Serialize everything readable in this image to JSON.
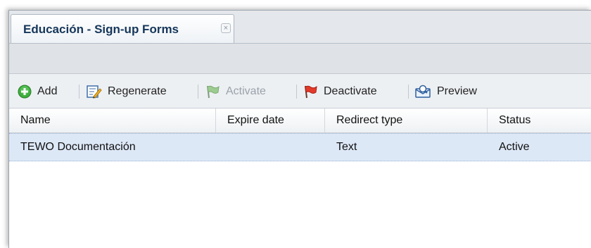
{
  "tab": {
    "title": "Educación - Sign-up Forms",
    "close_glyph": "×"
  },
  "toolbar": {
    "add": {
      "label": "Add",
      "icon": "add-icon"
    },
    "regenerate": {
      "label": "Regenerate",
      "icon": "regenerate-icon"
    },
    "activate": {
      "label": "Activate",
      "icon": "green-flag-icon",
      "disabled": true
    },
    "deactivate": {
      "label": "Deactivate",
      "icon": "red-flag-icon"
    },
    "preview": {
      "label": "Preview",
      "icon": "preview-icon"
    }
  },
  "grid": {
    "columns": [
      "Name",
      "Expire date",
      "Redirect type",
      "Status"
    ],
    "rows": [
      {
        "name": "TEWO Documentación",
        "expire_date": "",
        "redirect_type": "Text",
        "status": "Active",
        "selected": true
      }
    ]
  },
  "colors": {
    "tab_title": "#15365a",
    "selected_row": "#dde8f7",
    "disabled_text": "#9aa2ab"
  }
}
